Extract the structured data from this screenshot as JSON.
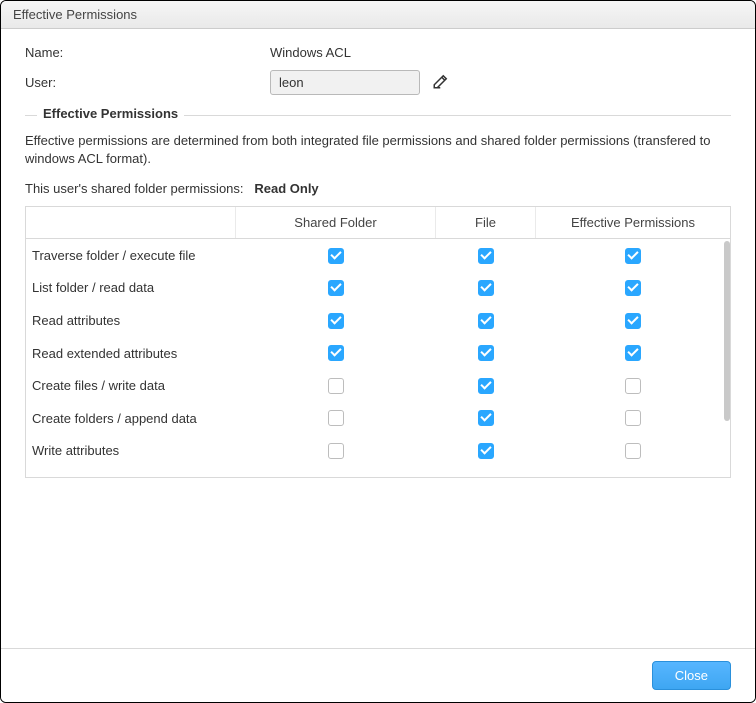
{
  "window": {
    "title": "Effective Permissions"
  },
  "form": {
    "name_label": "Name:",
    "name_value": "Windows ACL",
    "user_label": "User:",
    "user_value": "leon"
  },
  "section": {
    "legend": "Effective Permissions",
    "description": "Effective permissions are determined from both integrated file permissions and shared folder permissions (transfered to windows ACL format).",
    "perm_prefix": "This user's shared folder permissions:",
    "perm_value": "Read Only"
  },
  "table": {
    "headers": {
      "name": "",
      "shared": "Shared Folder",
      "file": "File",
      "effective": "Effective Permissions"
    },
    "rows": [
      {
        "name": "Traverse folder / execute file",
        "shared": true,
        "file": true,
        "effective": true
      },
      {
        "name": "List folder / read data",
        "shared": true,
        "file": true,
        "effective": true
      },
      {
        "name": "Read attributes",
        "shared": true,
        "file": true,
        "effective": true
      },
      {
        "name": "Read extended attributes",
        "shared": true,
        "file": true,
        "effective": true
      },
      {
        "name": "Create files / write data",
        "shared": false,
        "file": true,
        "effective": false
      },
      {
        "name": "Create folders / append data",
        "shared": false,
        "file": true,
        "effective": false
      },
      {
        "name": "Write attributes",
        "shared": false,
        "file": true,
        "effective": false
      }
    ]
  },
  "buttons": {
    "close": "Close"
  }
}
